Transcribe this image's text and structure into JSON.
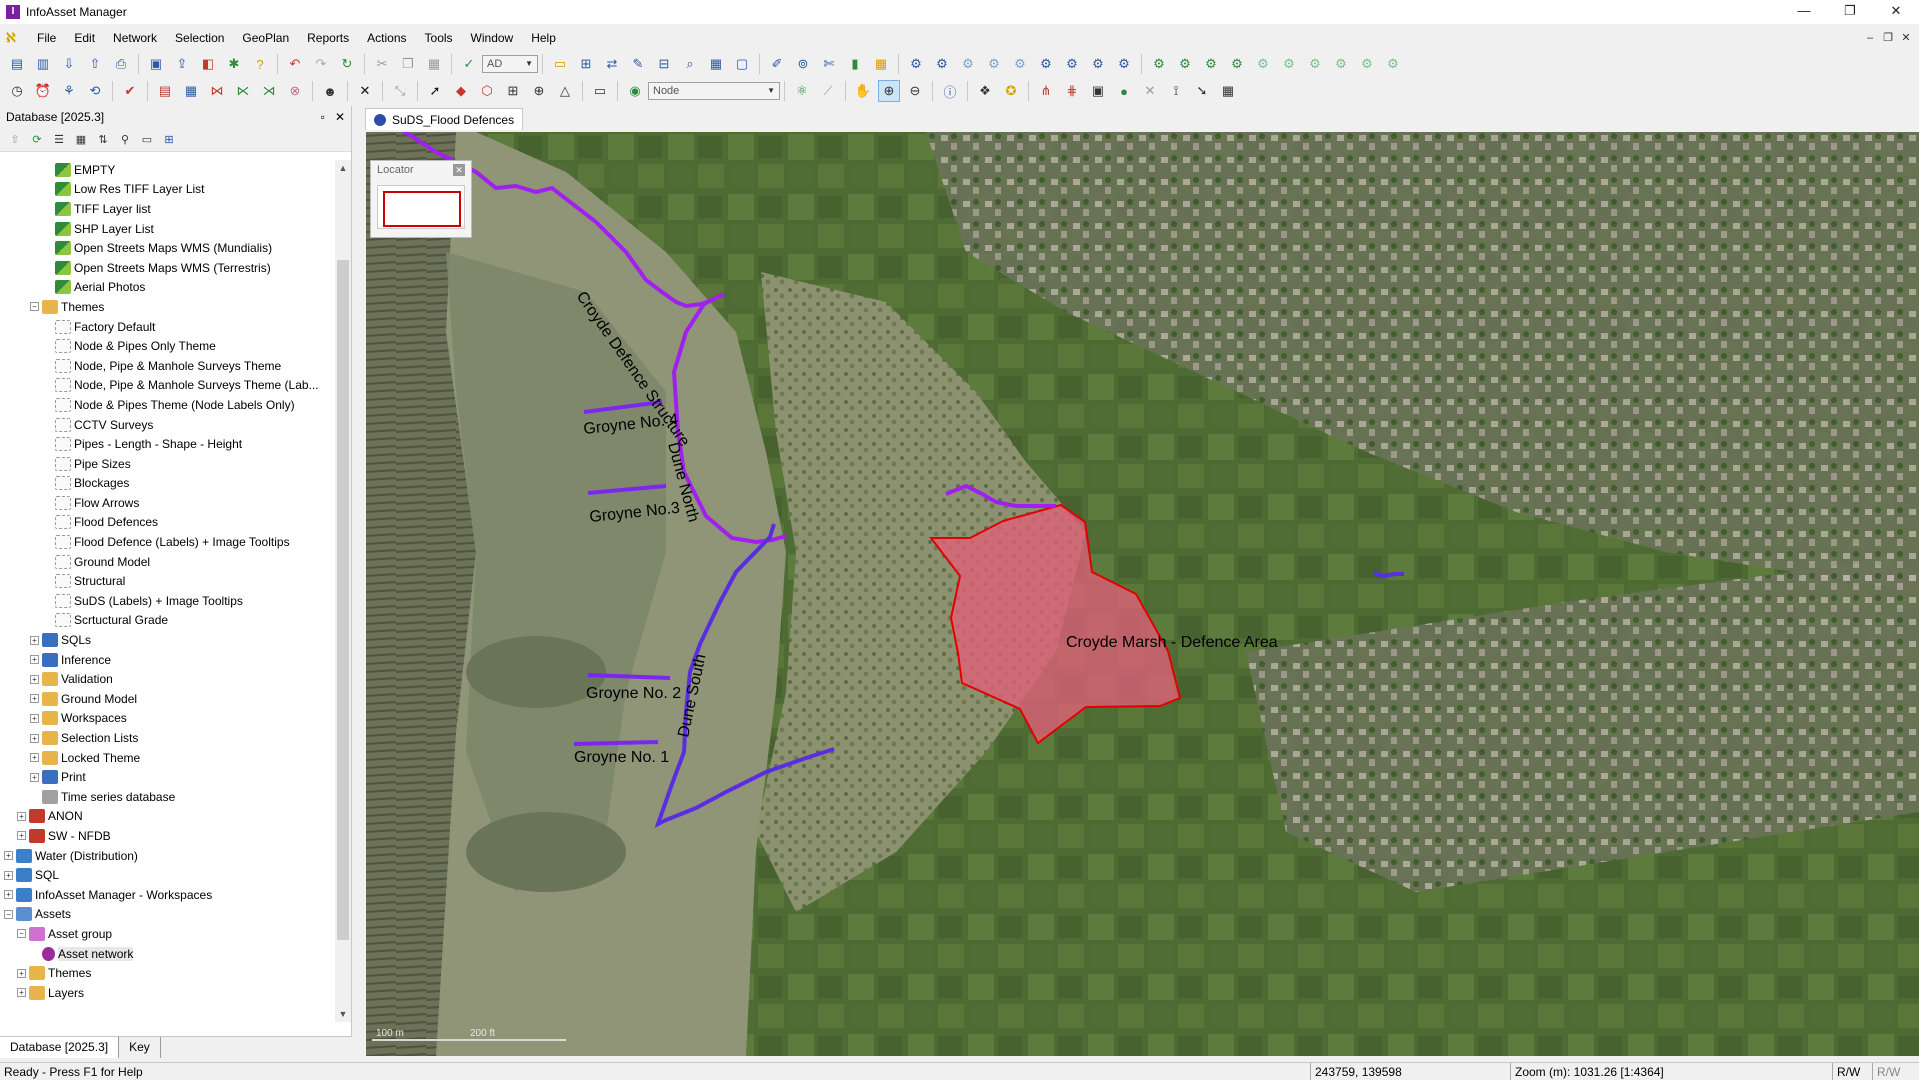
{
  "window": {
    "title": "InfoAsset Manager",
    "controls": [
      "—",
      "❐",
      "✕"
    ]
  },
  "menu": {
    "items": [
      "File",
      "Edit",
      "Network",
      "Selection",
      "GeoPlan",
      "Reports",
      "Actions",
      "Tools",
      "Window",
      "Help"
    ],
    "mdi_controls": [
      "–",
      "❐",
      "✕"
    ]
  },
  "toolbar": {
    "combo_ad": "AD",
    "combo_node": "Node"
  },
  "database_panel": {
    "title": "Database [2025.3]",
    "tree": [
      {
        "label": "EMPTY",
        "icon": "layer-list-icon",
        "level": 3,
        "exp": ""
      },
      {
        "label": "Low Res TIFF Layer List",
        "icon": "layer-list-icon",
        "level": 3,
        "exp": ""
      },
      {
        "label": "TIFF Layer list",
        "icon": "layer-list-icon",
        "level": 3,
        "exp": ""
      },
      {
        "label": "SHP Layer List",
        "icon": "layer-list-icon",
        "level": 3,
        "exp": ""
      },
      {
        "label": "Open Streets Maps WMS (Mundialis)",
        "icon": "layer-list-icon",
        "level": 3,
        "exp": ""
      },
      {
        "label": "Open Streets Maps WMS (Terrestris)",
        "icon": "layer-list-icon",
        "level": 3,
        "exp": ""
      },
      {
        "label": "Aerial Photos",
        "icon": "layer-list-icon",
        "level": 3,
        "exp": ""
      },
      {
        "label": "Themes",
        "icon": "folder-icon",
        "level": 2,
        "exp": "−"
      },
      {
        "label": "Factory Default",
        "icon": "theme-icon",
        "level": 3,
        "exp": ""
      },
      {
        "label": "Node & Pipes Only Theme",
        "icon": "theme-icon",
        "level": 3,
        "exp": ""
      },
      {
        "label": "Node, Pipe & Manhole Surveys Theme",
        "icon": "theme-icon",
        "level": 3,
        "exp": ""
      },
      {
        "label": "Node, Pipe & Manhole Surveys Theme (Lab...",
        "icon": "theme-icon",
        "level": 3,
        "exp": ""
      },
      {
        "label": "Node & Pipes Theme (Node Labels Only)",
        "icon": "theme-icon",
        "level": 3,
        "exp": ""
      },
      {
        "label": "CCTV Surveys",
        "icon": "theme-icon",
        "level": 3,
        "exp": ""
      },
      {
        "label": "Pipes - Length - Shape - Height",
        "icon": "theme-icon",
        "level": 3,
        "exp": ""
      },
      {
        "label": "Pipe Sizes",
        "icon": "theme-icon",
        "level": 3,
        "exp": ""
      },
      {
        "label": "Blockages",
        "icon": "theme-icon",
        "level": 3,
        "exp": ""
      },
      {
        "label": "Flow Arrows",
        "icon": "theme-icon",
        "level": 3,
        "exp": ""
      },
      {
        "label": "Flood Defences",
        "icon": "theme-icon",
        "level": 3,
        "exp": ""
      },
      {
        "label": "Flood Defence (Labels) + Image Tooltips",
        "icon": "theme-icon",
        "level": 3,
        "exp": ""
      },
      {
        "label": "Ground Model",
        "icon": "theme-icon",
        "level": 3,
        "exp": ""
      },
      {
        "label": "Structural",
        "icon": "theme-icon",
        "level": 3,
        "exp": ""
      },
      {
        "label": "SuDS (Labels) + Image Tooltips",
        "icon": "theme-icon",
        "level": 3,
        "exp": ""
      },
      {
        "label": "Scrtuctural Grade",
        "icon": "theme-icon",
        "level": 3,
        "exp": ""
      },
      {
        "label": "SQLs",
        "icon": "sql-folder-icon",
        "level": 2,
        "exp": "+"
      },
      {
        "label": "Inference",
        "icon": "sql-folder-icon",
        "level": 2,
        "exp": "+"
      },
      {
        "label": "Validation",
        "icon": "folder-icon",
        "level": 2,
        "exp": "+"
      },
      {
        "label": "Ground Model",
        "icon": "folder-icon",
        "level": 2,
        "exp": "+"
      },
      {
        "label": "Workspaces",
        "icon": "folder-icon",
        "level": 2,
        "exp": "+"
      },
      {
        "label": "Selection Lists",
        "icon": "folder-icon",
        "level": 2,
        "exp": "+"
      },
      {
        "label": "Locked Theme",
        "icon": "folder-icon",
        "level": 2,
        "exp": "+"
      },
      {
        "label": "Print",
        "icon": "sql-folder-icon",
        "level": 2,
        "exp": "+"
      },
      {
        "label": "Time series database",
        "icon": "timeseries-icon",
        "level": 2,
        "exp": ""
      },
      {
        "label": "ANON",
        "icon": "network-red-icon",
        "level": 1,
        "exp": "+"
      },
      {
        "label": "SW - NFDB",
        "icon": "network-red-icon",
        "level": 1,
        "exp": "+"
      },
      {
        "label": "Water (Distribution)",
        "icon": "network-icon",
        "level": 0,
        "exp": "+"
      },
      {
        "label": "SQL",
        "icon": "network-icon",
        "level": 0,
        "exp": "+"
      },
      {
        "label": "InfoAsset Manager - Workspaces",
        "icon": "network-icon",
        "level": 0,
        "exp": "+"
      },
      {
        "label": "Assets",
        "icon": "database-icon",
        "level": 0,
        "exp": "−"
      },
      {
        "label": "Asset group",
        "icon": "asset-group-icon",
        "level": 1,
        "exp": "−"
      },
      {
        "label": "Asset network",
        "icon": "asset-network-icon",
        "level": 2,
        "exp": "",
        "selected": true
      },
      {
        "label": "Themes",
        "icon": "folder-icon",
        "level": 1,
        "exp": "+"
      },
      {
        "label": "Layers",
        "icon": "folder-icon",
        "level": 1,
        "exp": "+"
      }
    ],
    "tabs": [
      "Database [2025.3]",
      "Key"
    ]
  },
  "document": {
    "tab_title": "SuDS_Flood Defences"
  },
  "map": {
    "locator_title": "Locator",
    "labels": {
      "croyde_defence": "Croyde Defence Structure",
      "groyne4": "Groyne No. 4",
      "groyne3": "Groyne No.3",
      "groyne2": "Groyne No. 2",
      "groyne1": "Groyne No. 1",
      "dune_north": "Dune North",
      "dune_south": "Dune South",
      "marsh": "Croyde Marsh - Defence Area"
    },
    "scale_labels": [
      "100 m",
      "200 ft"
    ],
    "colors": {
      "defence_line": "#a020f0",
      "dune_south_line": "#5a2ee0",
      "marsh_fill": "#e0607a",
      "marsh_border": "#e00000"
    }
  },
  "status": {
    "help": "Ready - Press F1 for Help",
    "coords": "243759, 139598",
    "zoom": "Zoom (m): 1031.26 [1:4364]",
    "rw1": "R/W",
    "rw2": "R/W"
  }
}
